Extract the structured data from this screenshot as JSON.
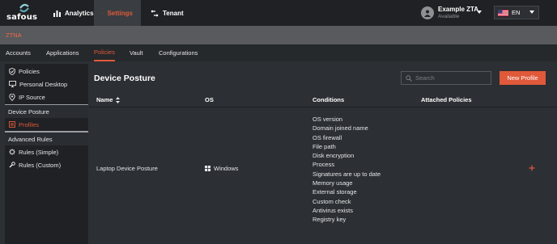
{
  "app": {
    "brand": "safous",
    "colors": {
      "accent": "#e0593a",
      "topbar": "#1f2124",
      "panel": "#2c2f33"
    }
  },
  "topnav": {
    "items": [
      {
        "label": "Analytics",
        "icon": "bar-chart-icon",
        "active": false
      },
      {
        "label": "Settings",
        "icon": "gear-icon",
        "active": true
      },
      {
        "label": "Tenant",
        "icon": "tenant-icon",
        "active": false
      }
    ],
    "user": {
      "name": "Example ZTA",
      "status": "Available",
      "icon": "avatar-icon"
    },
    "language": {
      "selected": "EN",
      "icon": "us-flag-icon"
    }
  },
  "module": {
    "label": "ZTNA"
  },
  "subtabs": [
    {
      "label": "Accounts",
      "active": false
    },
    {
      "label": "Applications",
      "active": false
    },
    {
      "label": "Policies",
      "active": true
    },
    {
      "label": "Vault",
      "active": false
    },
    {
      "label": "Configurations",
      "active": false
    }
  ],
  "sidebar": {
    "items_top": [
      {
        "label": "Policies",
        "icon": "shield-check-icon"
      },
      {
        "label": "Personal Desktop",
        "icon": "monitor-icon"
      },
      {
        "label": "IP Source",
        "icon": "location-pin-icon"
      }
    ],
    "section_device": {
      "label": "Device Posture"
    },
    "profiles": {
      "label": "Profiles",
      "icon": "profile-icon",
      "active": true
    },
    "section_advanced": {
      "label": "Advanced Rules"
    },
    "items_advanced": [
      {
        "label": "Rules (Simple)",
        "icon": "cog-icon"
      },
      {
        "label": "Rules (Custom)",
        "icon": "wrench-icon"
      }
    ]
  },
  "main": {
    "title": "Device Posture",
    "search": {
      "placeholder": "Search",
      "value": ""
    },
    "new_button": "New Profile",
    "columns": [
      "Name",
      "OS",
      "Conditions",
      "Attached Policies"
    ],
    "rows": [
      {
        "name": "Laptop Device Posture",
        "os": "Windows",
        "os_icon": "windows-icon",
        "conditions": [
          "OS version",
          "Domain joined name",
          "OS firewall",
          "File path",
          "Disk encryption",
          "Process",
          "Signatures are up to date",
          "Memory usage",
          "External storage",
          "Custom check",
          "Antivirus exists",
          "Registry key"
        ],
        "attached_policies_action": "+"
      }
    ]
  }
}
